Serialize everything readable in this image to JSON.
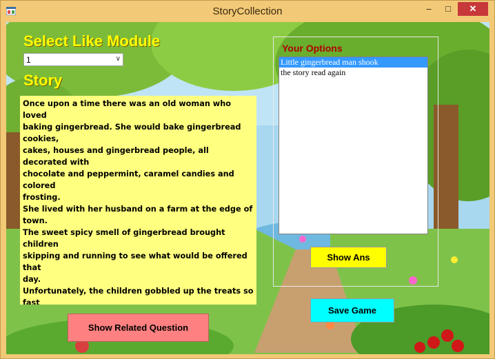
{
  "window": {
    "title": "StoryCollection",
    "controls": {
      "minimize": "–",
      "maximize": "□",
      "close": "✕"
    }
  },
  "module_label": "Select Like Module",
  "module_select": {
    "selected": "1"
  },
  "story_label": "Story",
  "story_text": "Once upon a time there was an old woman who loved\nbaking gingerbread. She would bake gingerbread cookies,\ncakes, houses and gingerbread people, all decorated with\nchocolate and peppermint, caramel candies and colored\nfrosting.\nShe lived with her husband on a farm at the edge of town.\nThe sweet spicy smell of gingerbread brought children\nskipping and running to see what would be offered that\nday.\nUnfortunately, the children gobbled up the treats so fast\nthat the old woman had a hard time keeping her supply of\nflour and spices to continue making the batches of\ngingerbread.",
  "options": {
    "title": "Your Options",
    "items": [
      "Little gingerbread man shook",
      "the story read again"
    ],
    "selected_index": 0
  },
  "buttons": {
    "show_ans": "Show Ans",
    "save_game": "Save Game",
    "show_related": "Show Related Question"
  },
  "colors": {
    "label_yellow": "#ffff00",
    "story_bg": "#ffff80",
    "options_title": "#b00000",
    "show_ans_bg": "#ffff00",
    "save_game_bg": "#00ffff",
    "show_related_bg": "#ff8080",
    "selection": "#3399ff"
  }
}
